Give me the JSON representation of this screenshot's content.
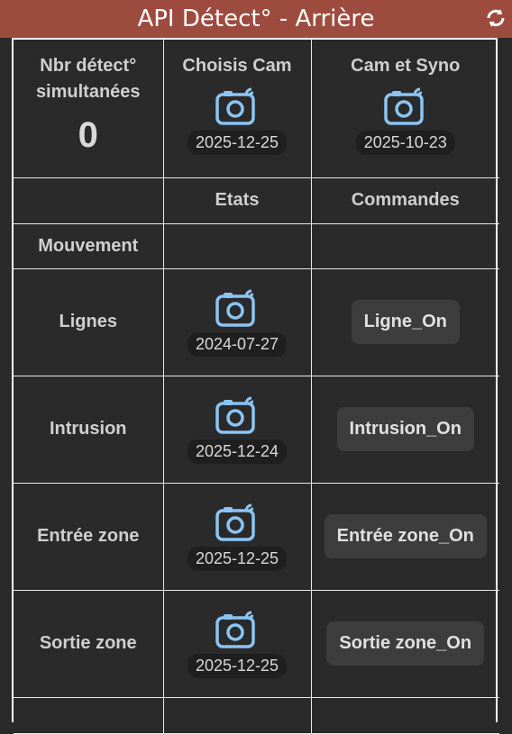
{
  "header": {
    "title": "API Détect° - Arrière",
    "refresh_icon": "refresh-icon"
  },
  "summary": {
    "count_label_line1": "Nbr détect°",
    "count_label_line2": "simultanées",
    "count_value": "0",
    "cam1_label": "Choisis Cam",
    "cam1_date": "2025-12-25",
    "cam2_label": "Cam et Syno",
    "cam2_date": "2025-10-23"
  },
  "columns": {
    "etats": "Etats",
    "commandes": "Commandes"
  },
  "section_label": "Mouvement",
  "rows": [
    {
      "label": "Lignes",
      "date": "2024-07-27",
      "command": "Ligne_On"
    },
    {
      "label": "Intrusion",
      "date": "2025-12-24",
      "command": "Intrusion_On"
    },
    {
      "label": "Entrée zone",
      "date": "2025-12-25",
      "command": "Entrée zone_On"
    },
    {
      "label": "Sortie zone",
      "date": "2025-12-25",
      "command": "Sortie zone_On"
    }
  ],
  "colors": {
    "header_bg": "#9e4b3f",
    "icon_blue": "#8cc4f2",
    "panel_bg": "#2a2a2a"
  }
}
